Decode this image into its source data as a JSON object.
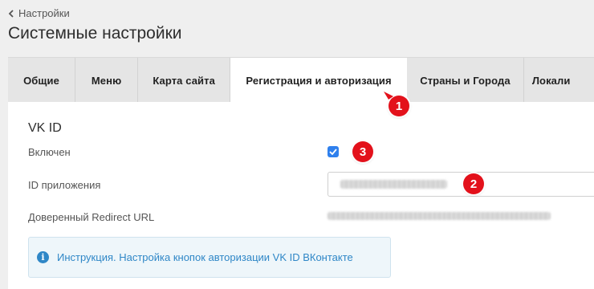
{
  "breadcrumb": {
    "back_label": "Настройки"
  },
  "page_title": "Системные настройки",
  "tabs": [
    {
      "label": "Общие",
      "active": false
    },
    {
      "label": "Меню",
      "active": false
    },
    {
      "label": "Карта сайта",
      "active": false
    },
    {
      "label": "Регистрация и авторизация",
      "active": true
    },
    {
      "label": "Страны и Города",
      "active": false
    },
    {
      "label": "Локали",
      "active": false
    }
  ],
  "section": {
    "title": "VK ID",
    "enabled_label": "Включен",
    "enabled_checked": true,
    "app_id_label": "ID приложения",
    "redirect_label": "Доверенный Redirect URL"
  },
  "info": {
    "text": "Инструкция. Настройка кнопок авторизации VK ID ВКонтакте"
  },
  "markers": {
    "tab": "1",
    "app_id": "2",
    "checkbox": "3"
  },
  "colors": {
    "accent": "#2f80ed",
    "marker": "#e3111b",
    "link": "#2f87c7"
  }
}
